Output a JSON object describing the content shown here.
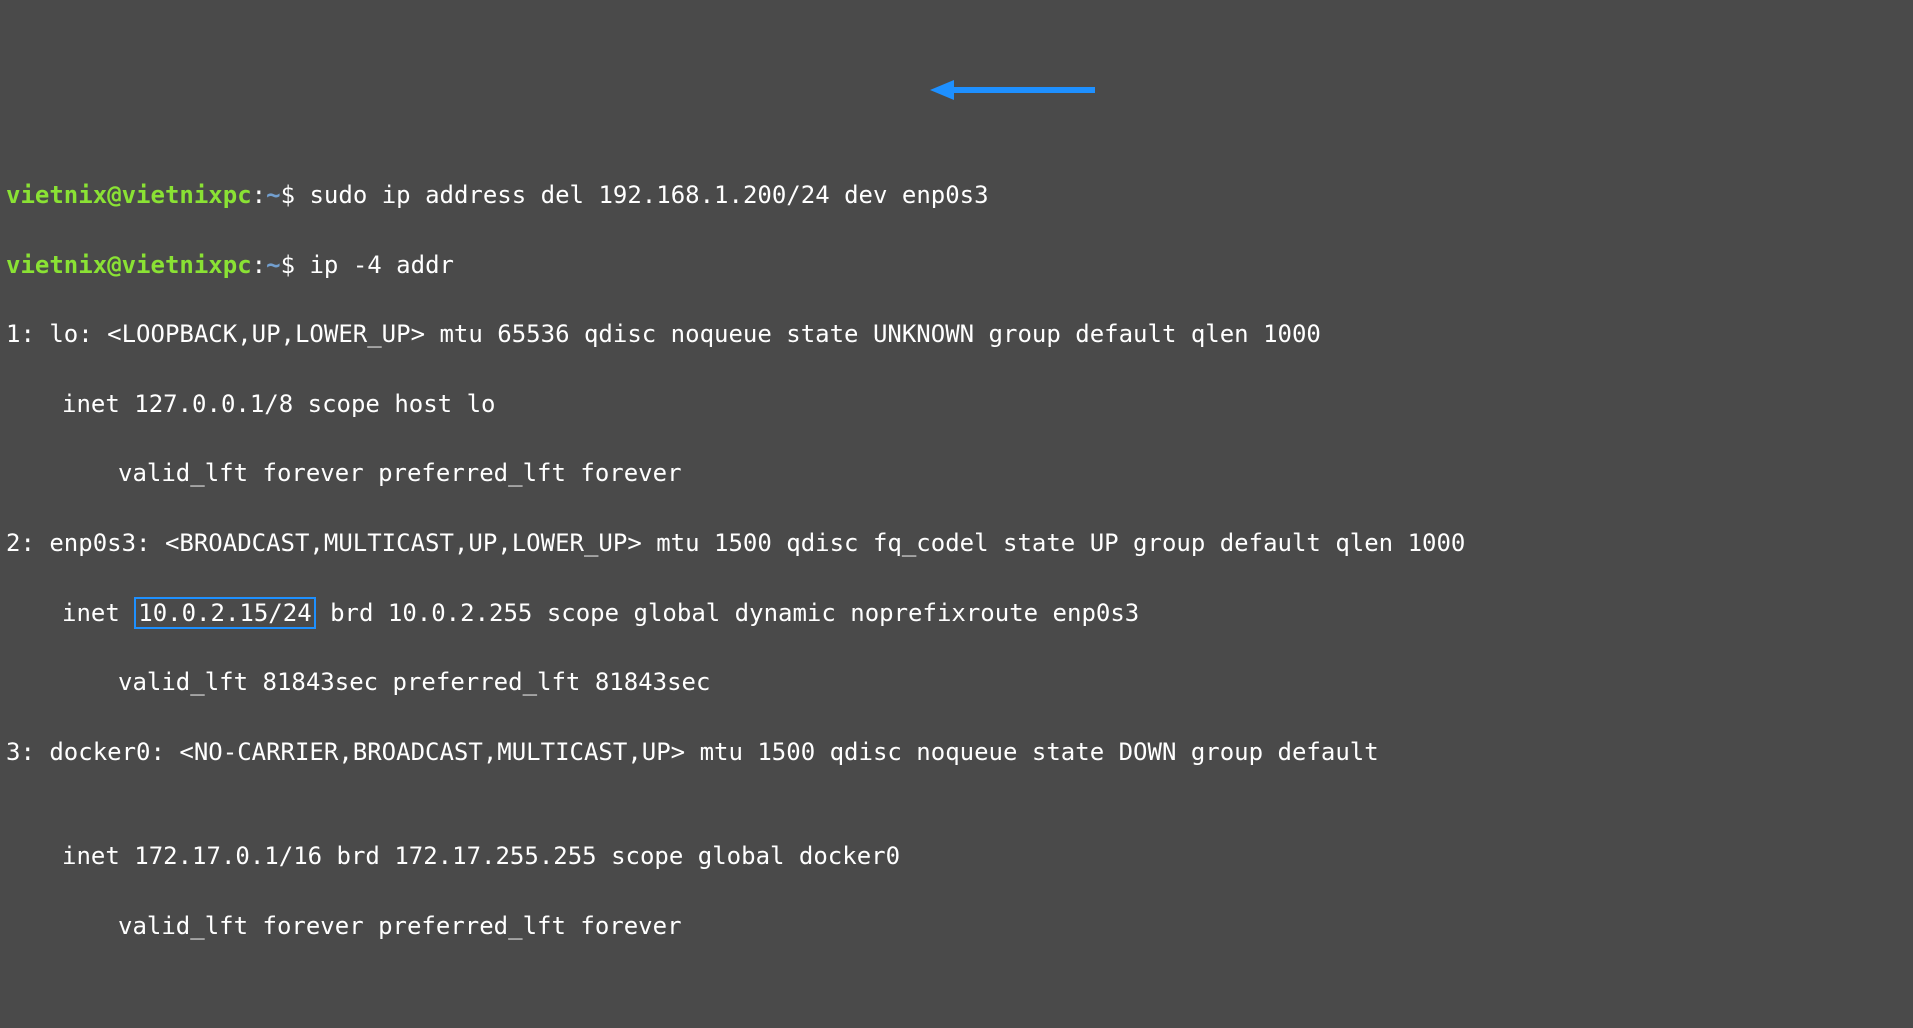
{
  "prompt": {
    "user": "vietnix",
    "at": "@",
    "host": "vietnixpc",
    "colon": ":",
    "path": "~",
    "dollar": "$"
  },
  "commands": {
    "cmd1": "sudo ip address del 192.168.1.200/24 dev enp0s3",
    "cmd2": "ip -4 addr"
  },
  "output": {
    "line1": "1: lo: <LOOPBACK,UP,LOWER_UP> mtu 65536 qdisc noqueue state UNKNOWN group default qlen 1000",
    "line2_prefix": "inet 127.0.0.1/8 scope host lo",
    "line3": "valid_lft forever preferred_lft forever",
    "line4": "2: enp0s3: <BROADCAST,MULTICAST,UP,LOWER_UP> mtu 1500 qdisc fq_codel state UP group default qlen 1000",
    "line5_prefix": "inet ",
    "line5_highlight": "10.0.2.15/24",
    "line5_suffix": " brd 10.0.2.255 scope global dynamic noprefixroute enp0s3",
    "line6": "valid_lft 81843sec preferred_lft 81843sec",
    "line7": "3: docker0: <NO-CARRIER,BROADCAST,MULTICAST,UP> mtu 1500 qdisc noqueue state DOWN group default ",
    "line8_blank": "",
    "line9": "inet 172.17.0.1/16 brd 172.17.255.255 scope global docker0",
    "line10": "valid_lft forever preferred_lft forever"
  },
  "annotations": {
    "arrow_color": "#1e90ff"
  }
}
